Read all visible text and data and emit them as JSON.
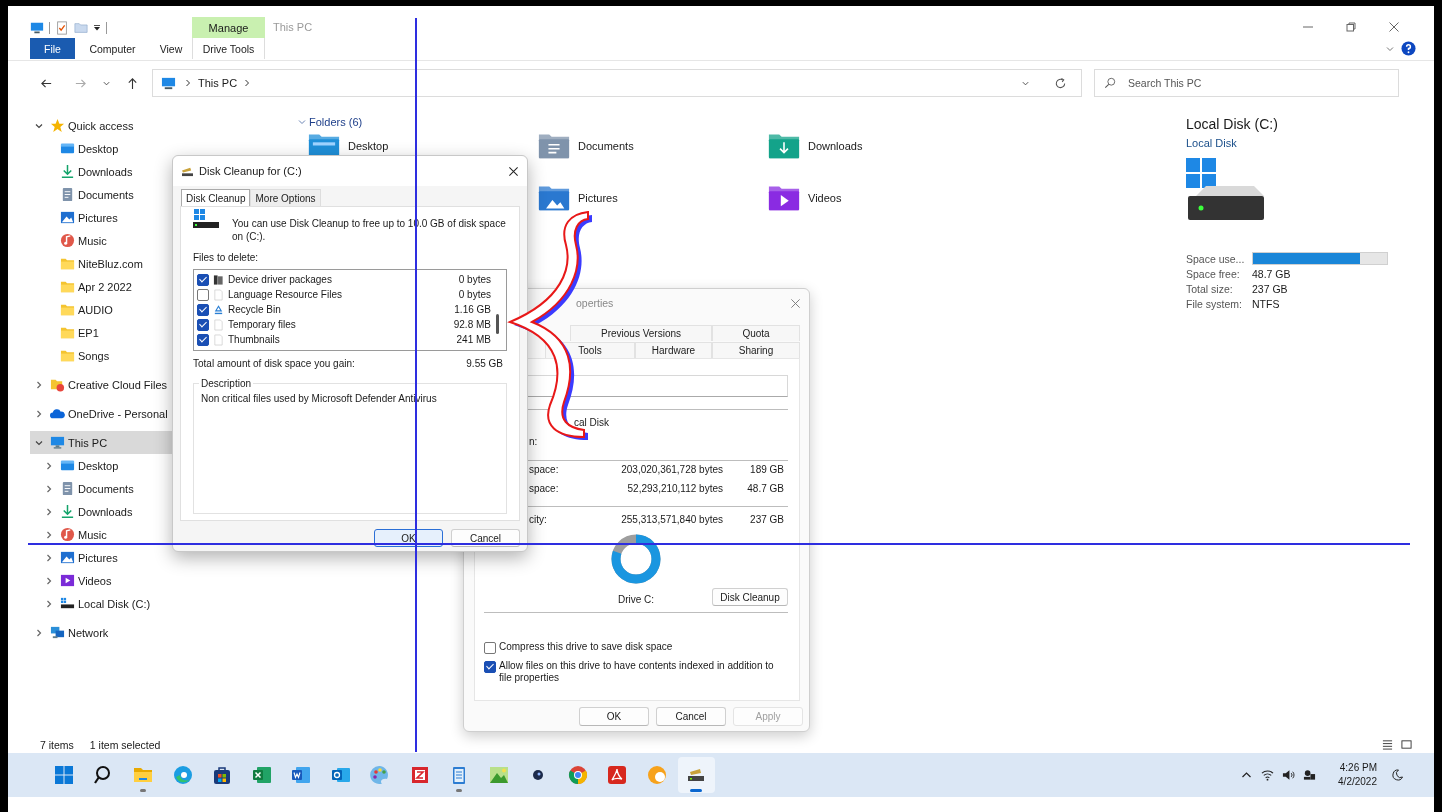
{
  "window": {
    "title": "This PC",
    "contextual_group": "Manage"
  },
  "ribbon": {
    "tabs": [
      {
        "label": "File",
        "kind": "file"
      },
      {
        "label": "Computer",
        "kind": "plain"
      },
      {
        "label": "View",
        "kind": "plain"
      },
      {
        "label": "Drive Tools",
        "kind": "contextual"
      }
    ]
  },
  "address_bar": {
    "path": [
      "This PC"
    ]
  },
  "search": {
    "placeholder": "Search This PC"
  },
  "sidebar": {
    "items": [
      {
        "label": "Quick access",
        "kind": "star",
        "expanded": true,
        "selected": false,
        "children": [
          {
            "label": "Desktop",
            "kind": "desktop",
            "selected": false
          },
          {
            "label": "Downloads",
            "kind": "downloads",
            "selected": false
          },
          {
            "label": "Documents",
            "kind": "documents",
            "selected": false
          },
          {
            "label": "Pictures",
            "kind": "pictures",
            "selected": false
          },
          {
            "label": "Music",
            "kind": "music",
            "selected": false
          },
          {
            "label": "NiteBluz.com",
            "kind": "folder",
            "selected": false
          },
          {
            "label": "Apr 2 2022",
            "kind": "folder",
            "selected": false
          },
          {
            "label": "AUDIO",
            "kind": "folder",
            "selected": false
          },
          {
            "label": "EP1",
            "kind": "folder",
            "selected": false
          },
          {
            "label": "Songs",
            "kind": "folder",
            "selected": false
          }
        ]
      },
      {
        "label": "Creative Cloud Files",
        "kind": "cloud-files",
        "expanded": false,
        "selected": false
      },
      {
        "label": "OneDrive - Personal",
        "kind": "onedrive",
        "expanded": false,
        "selected": false
      },
      {
        "label": "This PC",
        "kind": "pc",
        "expanded": true,
        "selected": true,
        "children": [
          {
            "label": "Desktop",
            "kind": "desktop",
            "expanded": false,
            "selected": false
          },
          {
            "label": "Documents",
            "kind": "documents",
            "expanded": false,
            "selected": false
          },
          {
            "label": "Downloads",
            "kind": "downloads",
            "expanded": false,
            "selected": false
          },
          {
            "label": "Music",
            "kind": "music",
            "expanded": false,
            "selected": false
          },
          {
            "label": "Pictures",
            "kind": "pictures",
            "expanded": false,
            "selected": false
          },
          {
            "label": "Videos",
            "kind": "videos",
            "expanded": false,
            "selected": false
          },
          {
            "label": "Local Disk (C:)",
            "kind": "drive",
            "expanded": false,
            "selected": false
          }
        ]
      },
      {
        "label": "Network",
        "kind": "network",
        "expanded": false,
        "selected": false
      }
    ]
  },
  "folders": {
    "header": "Folders (6)",
    "expanded": true,
    "items": [
      {
        "name": "Desktop",
        "kind": "desktop"
      },
      {
        "name": "Documents",
        "kind": "documents"
      },
      {
        "name": "Downloads",
        "kind": "downloads"
      },
      {
        "name": "Pictures",
        "kind": "pictures"
      },
      {
        "name": "Videos",
        "kind": "videos"
      }
    ]
  },
  "details": {
    "title": "Local Disk (C:)",
    "subtitle": "Local Disk",
    "space_used": {
      "label": "Space use...",
      "level": 0.8
    },
    "fields": [
      {
        "label": "Space free:",
        "value": "48.7 GB"
      },
      {
        "label": "Total size:",
        "value": "237 GB"
      },
      {
        "label": "File system:",
        "value": "NTFS"
      }
    ]
  },
  "status_bar": {
    "item_count": "7 items",
    "selection": "1 item selected"
  },
  "disk_cleanup_dialog": {
    "title": "Disk Cleanup for  (C:)",
    "tabs": [
      {
        "label": "Disk Cleanup",
        "selected": true
      },
      {
        "label": "More Options",
        "selected": false
      }
    ],
    "intro": "You can use Disk Cleanup to free up to 10.0 GB of disk space on (C:).",
    "files_label": "Files to delete:",
    "files": [
      {
        "name": "Device driver packages",
        "size": "0 bytes",
        "checked": true,
        "kind": "package"
      },
      {
        "name": "Language Resource Files",
        "size": "0 bytes",
        "checked": false,
        "kind": "file"
      },
      {
        "name": "Recycle Bin",
        "size": "1.16 GB",
        "checked": true,
        "kind": "recycle"
      },
      {
        "name": "Temporary files",
        "size": "92.8 MB",
        "checked": true,
        "kind": "file"
      },
      {
        "name": "Thumbnails",
        "size": "241 MB",
        "checked": true,
        "kind": "file"
      }
    ],
    "total_label": "Total amount of disk space you gain:",
    "total": "9.55 GB",
    "description_label": "Description",
    "description": "Non critical files used by Microsoft Defender Antivirus",
    "buttons": [
      {
        "label": "OK",
        "kind": "default"
      },
      {
        "label": "Cancel",
        "kind": "normal"
      }
    ]
  },
  "properties_dialog": {
    "title": "operties",
    "tabs_row_1": [
      {
        "label": "Previous Versions",
        "selected": false
      },
      {
        "label": "Quota",
        "selected": false
      }
    ],
    "tabs_row_2": [
      {
        "label": "Tools",
        "selected": false
      },
      {
        "label": "Hardware",
        "selected": false
      },
      {
        "label": "Sharing",
        "selected": false
      }
    ],
    "type_fragment": "cal Disk",
    "file_system_fragment": "n:",
    "rows": [
      {
        "label": "space:",
        "bytes": "203,020,361,728 bytes",
        "size": "189 GB"
      },
      {
        "label": "space:",
        "bytes": "52,293,210,112 bytes",
        "size": "48.7 GB"
      }
    ],
    "capacity": {
      "label": "city:",
      "bytes": "255,313,571,840 bytes",
      "size": "237 GB"
    },
    "drive_label": "Drive C:",
    "cleanup_button": "Disk Cleanup",
    "options": [
      {
        "label": "Compress this drive to save disk space",
        "checked": false
      },
      {
        "label": "Allow files on this drive to have contents indexed in addition to file properties",
        "checked": true
      }
    ],
    "buttons": [
      {
        "label": "OK",
        "disabled": false
      },
      {
        "label": "Cancel",
        "disabled": false
      },
      {
        "label": "Apply",
        "disabled": true
      }
    ]
  },
  "taskbar": {
    "apps": [
      {
        "kind": "start",
        "running": false,
        "selected": false
      },
      {
        "kind": "search",
        "running": false,
        "selected": false
      },
      {
        "kind": "explorer",
        "running": true,
        "selected": false
      },
      {
        "kind": "edge",
        "running": false,
        "selected": false
      },
      {
        "kind": "store",
        "running": false,
        "selected": false
      },
      {
        "kind": "excel",
        "running": false,
        "selected": false
      },
      {
        "kind": "word",
        "running": false,
        "selected": false
      },
      {
        "kind": "outlook",
        "running": false,
        "selected": false
      },
      {
        "kind": "paint",
        "running": false,
        "selected": false
      },
      {
        "kind": "archive",
        "running": false,
        "selected": false
      },
      {
        "kind": "notepad",
        "running": true,
        "selected": false
      },
      {
        "kind": "image",
        "running": false,
        "selected": false
      },
      {
        "kind": "disc",
        "running": false,
        "selected": false
      },
      {
        "kind": "chrome",
        "running": false,
        "selected": false
      },
      {
        "kind": "pdf",
        "running": false,
        "selected": false
      },
      {
        "kind": "orange",
        "running": false,
        "selected": false
      },
      {
        "kind": "cleanup",
        "running": true,
        "selected": true
      }
    ],
    "time": "4:26 PM",
    "date": "4/2/2022"
  }
}
